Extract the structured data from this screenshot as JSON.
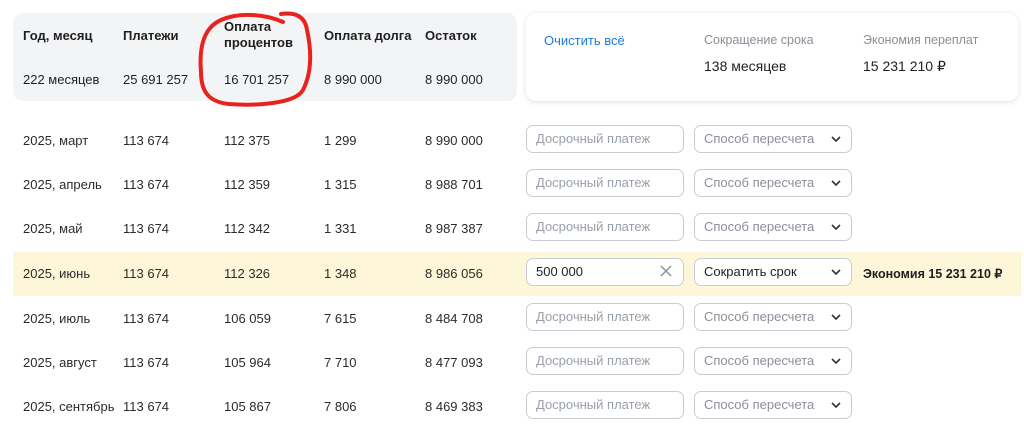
{
  "summary": {
    "headers": {
      "period": "Год, месяц",
      "payments": "Платежи",
      "interest_line1": "Оплата",
      "interest_line2": "процентов",
      "principal": "Оплата долга",
      "balance": "Остаток"
    },
    "totals": {
      "period": "222 месяцев",
      "payments": "25 691 257",
      "interest": "16 701 257",
      "principal": "8 990 000",
      "balance": "8 990 000"
    }
  },
  "stats": {
    "clear_all": "Очистить всё",
    "term_reduction_label": "Сокращение срока",
    "term_reduction_value": "138 месяцев",
    "overpay_savings_label": "Экономия переплат",
    "overpay_savings_value": "15 231 210 ₽"
  },
  "placeholders": {
    "payment": "Досрочный платеж",
    "method": "Способ пересчета"
  },
  "rows": [
    {
      "period": "2025, март",
      "payment": "113 674",
      "interest": "112 375",
      "principal": "1 299",
      "balance": "8 990 000"
    },
    {
      "period": "2025, апрель",
      "payment": "113 674",
      "interest": "112 359",
      "principal": "1 315",
      "balance": "8 988 701"
    },
    {
      "period": "2025, май",
      "payment": "113 674",
      "interest": "112 342",
      "principal": "1 331",
      "balance": "8 987 387"
    },
    {
      "period": "2025, июнь",
      "payment": "113 674",
      "interest": "112 326",
      "principal": "1 348",
      "balance": "8 986 056",
      "early_payment": "500 000",
      "method": "Сократить срок",
      "note": "Экономия 15 231 210 ₽"
    },
    {
      "period": "2025, июль",
      "payment": "113 674",
      "interest": "106 059",
      "principal": "7 615",
      "balance": "8 484 708"
    },
    {
      "period": "2025, август",
      "payment": "113 674",
      "interest": "105 964",
      "principal": "7 710",
      "balance": "8 477 093"
    },
    {
      "period": "2025, сентябрь",
      "payment": "113 674",
      "interest": "105 867",
      "principal": "7 806",
      "balance": "8 469 383"
    }
  ],
  "colors": {
    "accent_link": "#1e7ae0",
    "highlight_row": "#fdf6d8",
    "annotation_red": "#e8231e"
  },
  "icons": {
    "clear": "close-icon",
    "dropdown": "chevron-down-icon"
  }
}
